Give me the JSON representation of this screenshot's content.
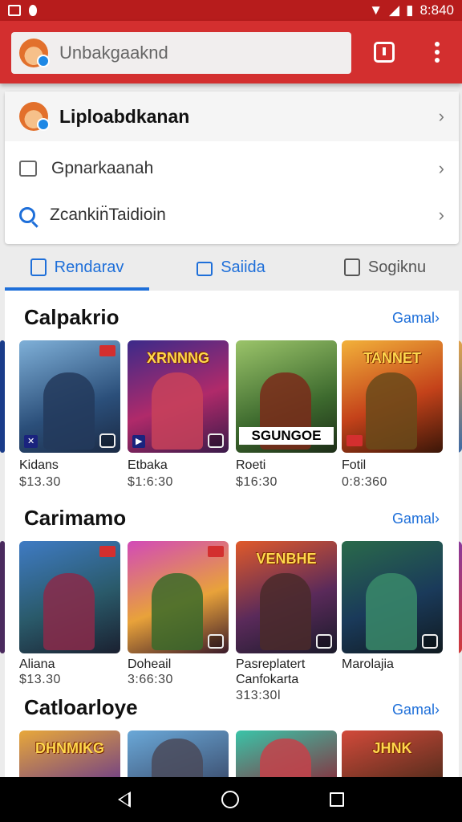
{
  "status_bar": {
    "time": "8:840"
  },
  "header": {
    "search_text": "Unbakgaaknd"
  },
  "account": {
    "profile_name": "Liploabdkanan",
    "rows": [
      {
        "label": "Gpnarkaanah"
      },
      {
        "label": "Zcankin̈Taidioin"
      }
    ]
  },
  "tabs": [
    {
      "label": "Rendarav",
      "active": true
    },
    {
      "label": "Saiida"
    },
    {
      "label": "Sogiknu"
    }
  ],
  "sections": [
    {
      "title": "Calpakrio",
      "more": "Gamal",
      "items": [
        {
          "name": "Kidans",
          "price": "$13.30",
          "banner": "",
          "strip": ""
        },
        {
          "name": "Etbaka",
          "price": "$1:6:30",
          "banner": "XRNNNG",
          "strip": ""
        },
        {
          "name": "Roeti",
          "price": "$16:30",
          "banner": "",
          "strip": "SGUNGOE"
        },
        {
          "name": "Fotil",
          "price": "0:8:360",
          "banner": "TANNET",
          "strip": ""
        }
      ]
    },
    {
      "title": "Carimamo",
      "more": "Gamal",
      "items": [
        {
          "name": "Aliana",
          "price": "$13.30",
          "banner": "",
          "strip": ""
        },
        {
          "name": "Doheail",
          "price": "3:66:30",
          "banner": "",
          "strip": ""
        },
        {
          "name": "Pasreplatert Canfokarta",
          "price": "313:30l",
          "banner": "VENBHE",
          "strip": ""
        },
        {
          "name": "Marolajia",
          "price": "",
          "banner": "",
          "strip": ""
        }
      ]
    },
    {
      "title": "Catloarloye",
      "more": "Gamal",
      "items": [
        {
          "banner": "DHNMIKG"
        },
        {
          "banner": ""
        },
        {
          "banner": ""
        },
        {
          "banner": "JHNK"
        }
      ]
    }
  ],
  "colors": {
    "header_red": "#d32f2f",
    "status_red": "#b71c1c",
    "accent_blue": "#1e6fd9"
  }
}
